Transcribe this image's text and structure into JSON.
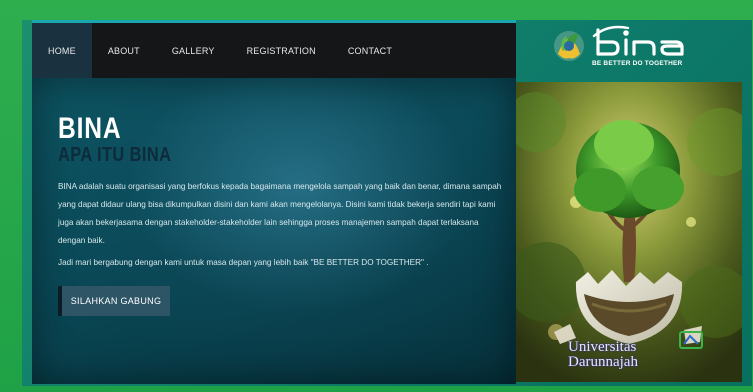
{
  "nav": {
    "items": [
      "HOME",
      "ABOUT",
      "GALLERY",
      "REGISTRATION",
      "CONTACT"
    ],
    "active_index": 0
  },
  "logo": {
    "wordmark": "bina",
    "tagline": "BE BETTER DO TOGETHER"
  },
  "hero": {
    "title": "BINA",
    "subtitle": "APA ITU BINA",
    "paragraph1": "BINA adalah suatu organisasi yang berfokus kepada bagaimana mengelola sampah yang baik dan benar, dimana sampah yang dapat didaur ulang bisa dikumpulkan disini dan kami akan mengelolanya. Disini kami tidak bekerja sendiri tapi kami juga akan bekerjasama dengan stakeholder-stakeholder lain sehingga proses manajemen sampah dapat terlaksana dengan baik.",
    "paragraph2": "Jadi mari bergabung dengan kami untuk masa depan yang lebih baik \"BE BETTER DO TOGETHER\" .",
    "button_label": "SILAHKAN GABUNG"
  },
  "photo": {
    "university_line1": "Universitas",
    "university_line2": "Darunnajah"
  },
  "colors": {
    "frame_green": "#2fae4e",
    "navbar": "#151617",
    "nav_active": "#1a3140",
    "hero_bg": "#0a4a58",
    "button_bg": "#2d5566"
  },
  "icons": [
    "bina-leaf-hands-icon",
    "darunnajah-logo-icon"
  ]
}
